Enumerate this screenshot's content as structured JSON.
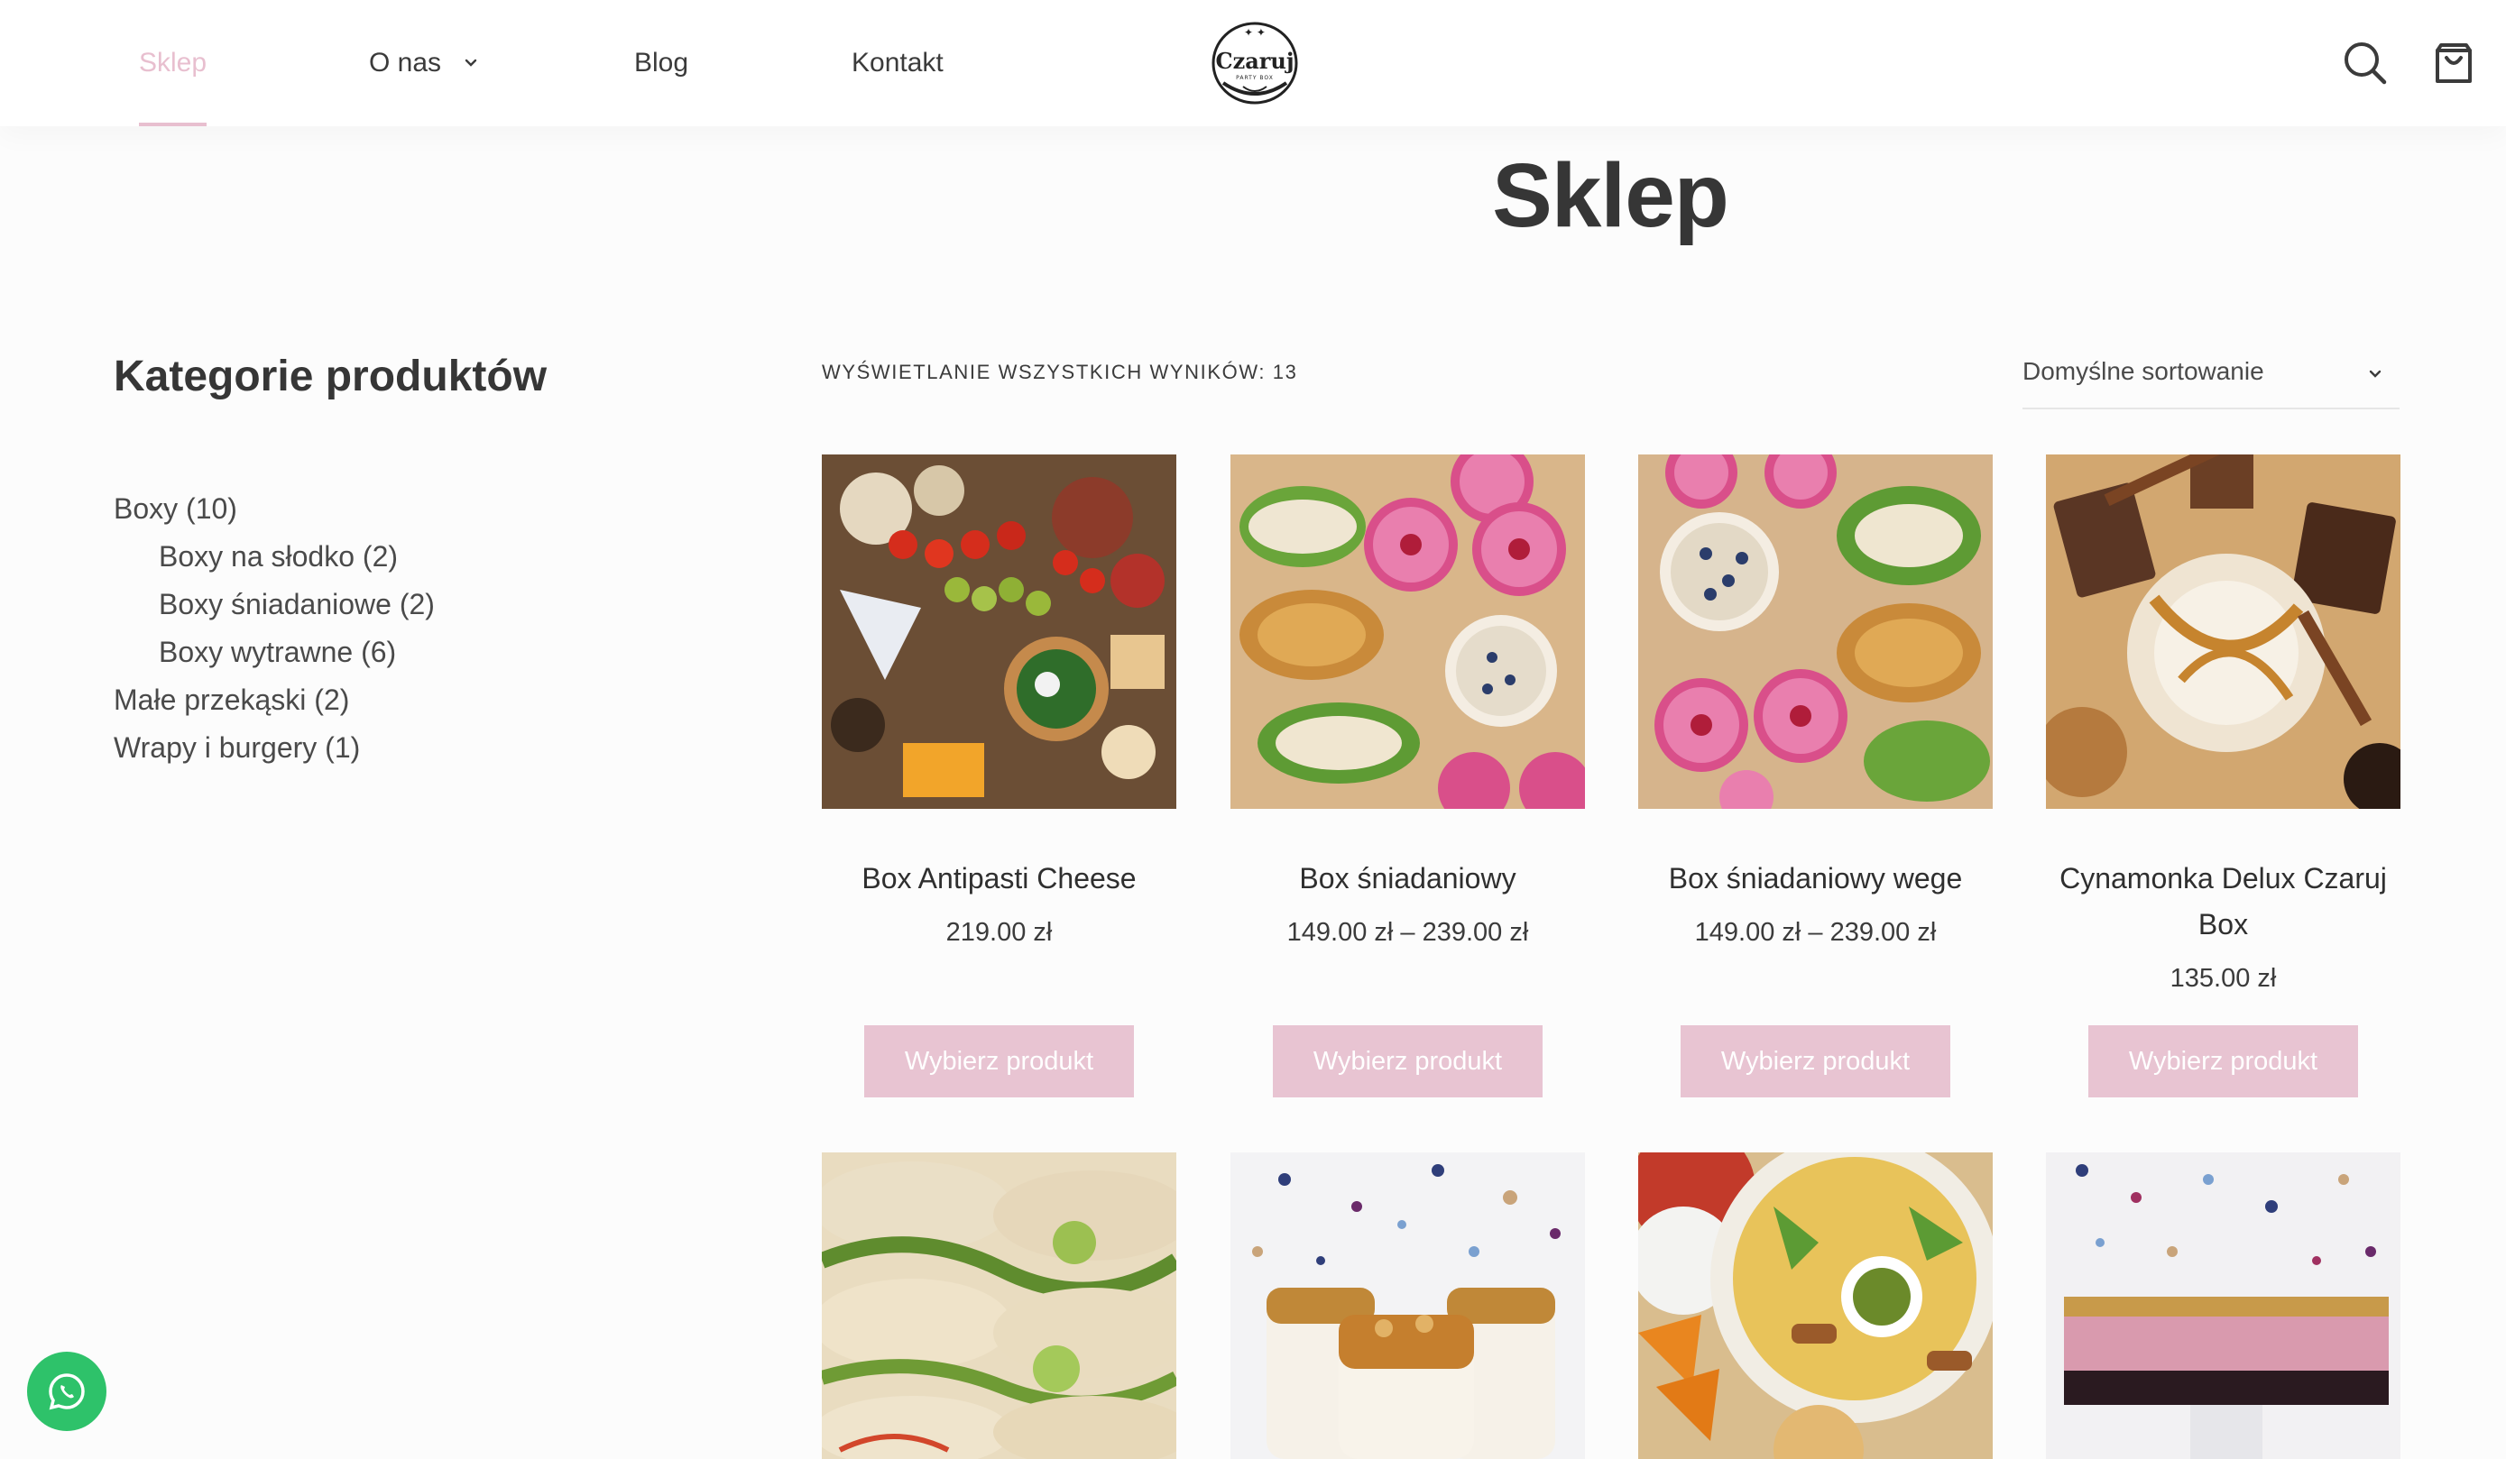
{
  "header": {
    "nav": [
      {
        "label": "Sklep",
        "active": true
      },
      {
        "label": "O nas",
        "has_dropdown": true
      },
      {
        "label": "Blog"
      },
      {
        "label": "Kontakt"
      }
    ],
    "logo_text": "Czaruj",
    "logo_subtext": "PARTY BOX",
    "icons": [
      "search-icon",
      "cart-icon"
    ]
  },
  "page": {
    "title": "Sklep"
  },
  "sidebar": {
    "title": "Kategorie produktów",
    "categories": [
      {
        "label": "Boxy (10)",
        "level": 0
      },
      {
        "label": "Boxy na słodko (2)",
        "level": 1
      },
      {
        "label": "Boxy śniadaniowe (2)",
        "level": 1
      },
      {
        "label": "Boxy wytrawne (6)",
        "level": 1
      },
      {
        "label": "Małe przekąski (2)",
        "level": 0
      },
      {
        "label": "Wrapy i burgery (1)",
        "level": 0
      }
    ]
  },
  "toolbar": {
    "result_count": "WYŚWIETLANIE WSZYSTKICH WYNIKÓW: 13",
    "sort_selected": "Domyślne sortowanie"
  },
  "products": [
    {
      "title": "Box Antipasti Cheese",
      "price": "219.00 zł",
      "button": "Wybierz produkt"
    },
    {
      "title": "Box śniadaniowy",
      "price": "149.00 zł – 239.00 zł",
      "button": "Wybierz produkt"
    },
    {
      "title": "Box śniadaniowy wege",
      "price": "149.00 zł – 239.00 zł",
      "button": "Wybierz produkt"
    },
    {
      "title": "Cynamonka Delux Czaruj Box",
      "price": "135.00 zł",
      "button": "Wybierz produkt"
    }
  ],
  "colors": {
    "accent": "#e8bfcf",
    "button_bg": "#e8c4d2",
    "whatsapp": "#2ec26a",
    "text": "#3b3b3b"
  },
  "floating": {
    "icon": "whatsapp-icon"
  }
}
